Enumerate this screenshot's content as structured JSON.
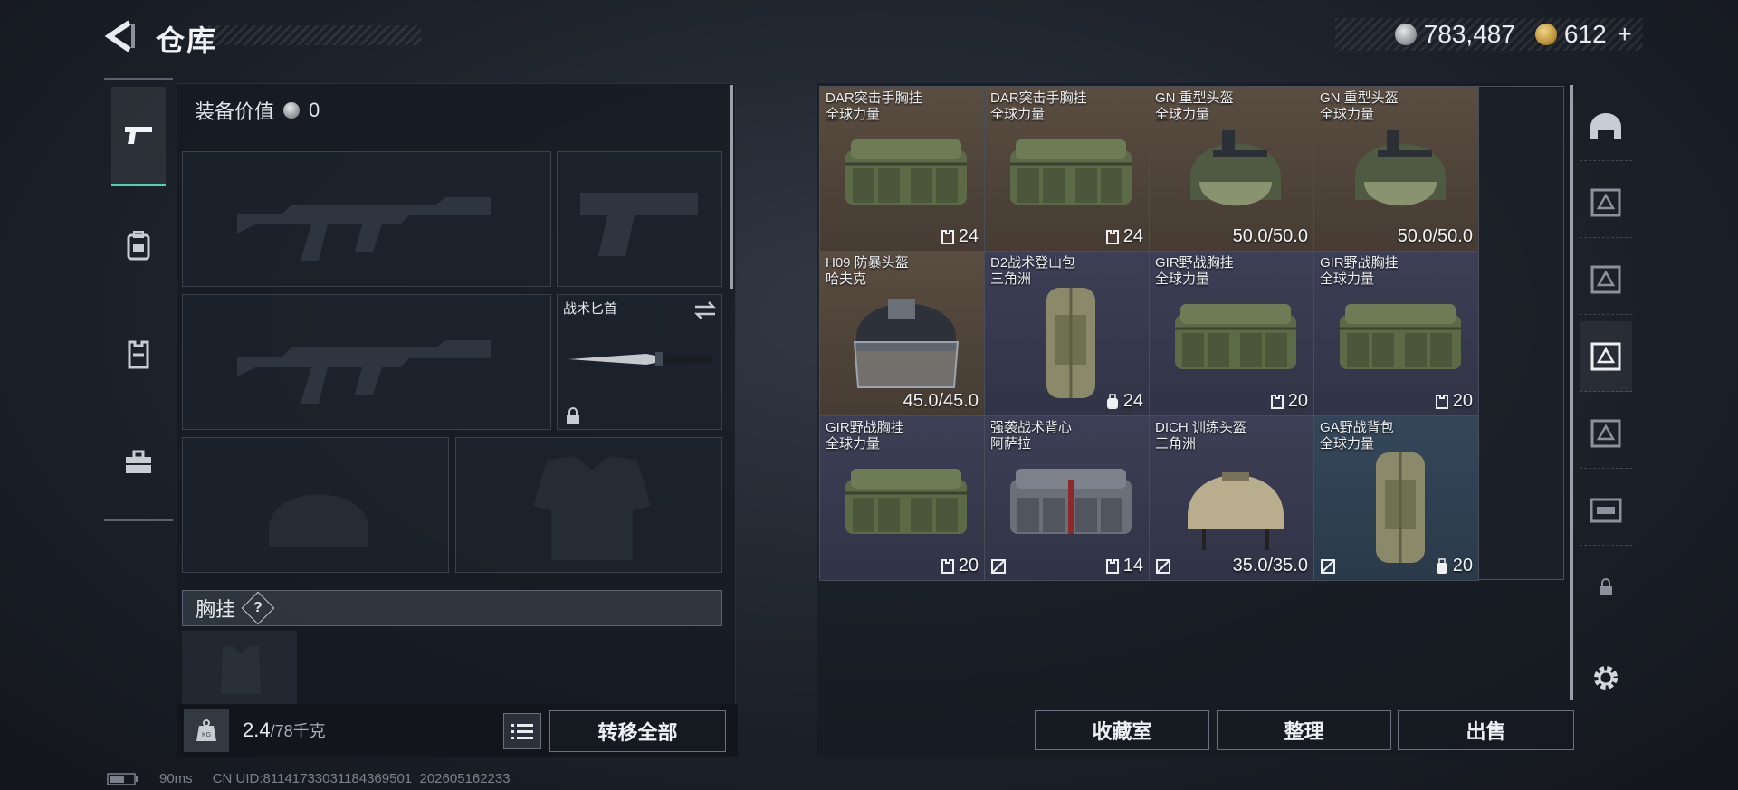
{
  "header": {
    "title": "仓库",
    "currency": [
      {
        "icon": "silver-coin-icon",
        "value": "783,487"
      },
      {
        "icon": "gold-coin-icon",
        "value": "612",
        "add_label": "+"
      }
    ]
  },
  "left_nav": [
    "pistol-icon",
    "backpack-icon",
    "vest-icon",
    "toolbox-icon"
  ],
  "loadout": {
    "equip_value_label": "装备价值",
    "equip_value": "0",
    "knife_label": "战术匕首",
    "chest_rig_label": "胸挂",
    "help_label": "?",
    "weight_value": "2.4",
    "weight_max": "/78千克",
    "transfer_all_label": "转移全部"
  },
  "stash": {
    "items": [
      {
        "name": "DAR突击手胸挂",
        "sub": "全球力量",
        "value": "24",
        "value_icon": "vest-capacity-icon",
        "rarity": "brown",
        "art": "rig",
        "nosell": false
      },
      {
        "name": "DAR突击手胸挂",
        "sub": "全球力量",
        "value": "24",
        "value_icon": "vest-capacity-icon",
        "rarity": "brown",
        "art": "rig",
        "nosell": false
      },
      {
        "name": "GN 重型头盔",
        "sub": "全球力量",
        "value": "50.0/50.0",
        "value_icon": "",
        "rarity": "brown",
        "art": "heavyhelmet",
        "nosell": false
      },
      {
        "name": "GN 重型头盔",
        "sub": "全球力量",
        "value": "50.0/50.0",
        "value_icon": "",
        "rarity": "brown",
        "art": "heavyhelmet",
        "nosell": false
      },
      {
        "name": "H09 防暴头盔",
        "sub": "哈夫克",
        "value": "45.0/45.0",
        "value_icon": "",
        "rarity": "brown",
        "art": "riothelmet",
        "nosell": false
      },
      {
        "name": "D2战术登山包",
        "sub": "三角洲",
        "value": "24",
        "value_icon": "backpack-capacity-icon",
        "rarity": "purple",
        "art": "tallbag",
        "nosell": false
      },
      {
        "name": "GIR野战胸挂",
        "sub": "全球力量",
        "value": "20",
        "value_icon": "vest-capacity-icon",
        "rarity": "purple",
        "art": "rig",
        "nosell": false
      },
      {
        "name": "GIR野战胸挂",
        "sub": "全球力量",
        "value": "20",
        "value_icon": "vest-capacity-icon",
        "rarity": "purple",
        "art": "rig",
        "nosell": false
      },
      {
        "name": "GIR野战胸挂",
        "sub": "全球力量",
        "value": "20",
        "value_icon": "vest-capacity-icon",
        "rarity": "purple",
        "art": "rig",
        "nosell": false
      },
      {
        "name": "强袭战术背心",
        "sub": "阿萨拉",
        "value": "14",
        "value_icon": "vest-capacity-icon",
        "rarity": "purple",
        "art": "greyrig",
        "nosell": true
      },
      {
        "name": "DICH 训练头盔",
        "sub": "三角洲",
        "value": "35.0/35.0",
        "value_icon": "",
        "rarity": "purple",
        "art": "tanhelmet",
        "nosell": true
      },
      {
        "name": "GA野战背包",
        "sub": "全球力量",
        "value": "20",
        "value_icon": "backpack-capacity-icon",
        "rarity": "blue",
        "art": "tallbag",
        "nosell": true
      }
    ],
    "buttons": {
      "collection": "收藏室",
      "organize": "整理",
      "sell": "出售"
    }
  },
  "right_nav": [
    "helmet-category-icon",
    "armor-category-icon",
    "armor-category-icon",
    "armor-category-icon",
    "armor-category-icon",
    "rig-category-icon",
    "lock-icon",
    "settings-icon"
  ],
  "status": {
    "ping": "90ms",
    "uid": "CN UID:81141733031184369501_202605162233"
  },
  "colors": {
    "accent": "#4fd1b3",
    "brown": "#5a4d41",
    "purple": "#3d3f56",
    "blue": "#34475a"
  }
}
